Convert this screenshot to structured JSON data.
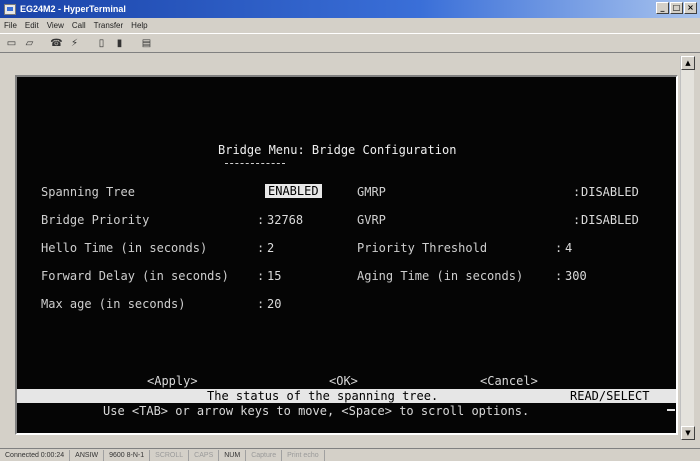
{
  "window": {
    "title": "EG24M2 - HyperTerminal",
    "minimize_glyph": "_",
    "maximize_glyph": "□",
    "close_glyph": "×"
  },
  "menu": [
    "File",
    "Edit",
    "View",
    "Call",
    "Transfer",
    "Help"
  ],
  "toolbar": [
    "new-icon",
    "open-icon",
    "dial-icon",
    "disconnect-icon",
    "send-icon",
    "receive-icon",
    "properties-icon"
  ],
  "terminal": {
    "heading": "Bridge Menu: Bridge Configuration",
    "left_fields": [
      {
        "label": "Spanning Tree",
        "sep": "",
        "value": "ENABLED"
      },
      {
        "label": "Bridge Priority",
        "sep": ":",
        "value": "32768"
      },
      {
        "label": "Hello Time (in seconds)",
        "sep": ":",
        "value": "2"
      },
      {
        "label": "Forward Delay (in seconds)",
        "sep": ":",
        "value": "15"
      },
      {
        "label": "Max age (in seconds)",
        "sep": ":",
        "value": "20"
      }
    ],
    "right_fields": [
      {
        "label": "GMRP",
        "sep": ":",
        "value": "DISABLED"
      },
      {
        "label": "GVRP",
        "sep": ":",
        "value": "DISABLED"
      },
      {
        "label": "Priority Threshold",
        "sep": ":",
        "value": "4"
      },
      {
        "label": "Aging Time (in seconds)",
        "sep": ":",
        "value": "300"
      }
    ],
    "actions": {
      "apply": "<Apply>",
      "ok": "<OK>",
      "cancel": "<Cancel>"
    },
    "hint": "The status of the spanning tree.",
    "mode": "READ/SELECT",
    "help_line": "Use <TAB> or arrow keys to move, <Space> to scroll options."
  },
  "statusbar": [
    "Connected 0:00:24",
    "ANSIW",
    "9600 8-N-1",
    "SCROLL",
    "CAPS",
    "NUM",
    "Capture",
    "Print echo"
  ]
}
